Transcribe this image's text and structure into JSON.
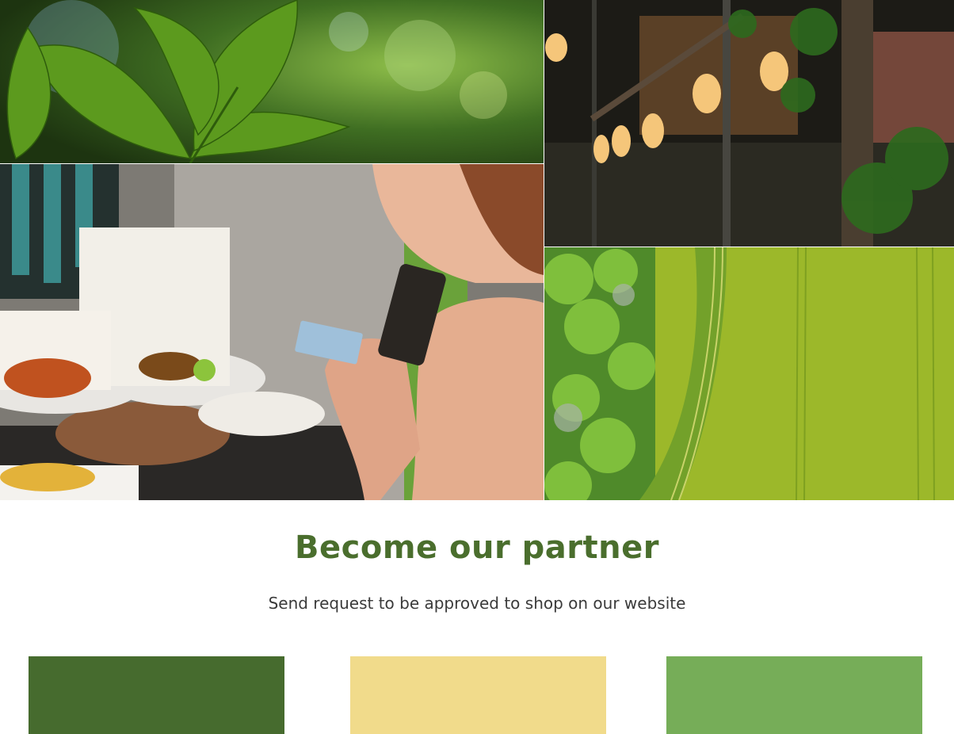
{
  "partner": {
    "title": "Become our partner",
    "subtitle": "Send request to be approved to shop on our website"
  },
  "images": [
    {
      "name": "green-leaves-photo"
    },
    {
      "name": "cafe-lights-photo"
    },
    {
      "name": "food-payment-photo"
    },
    {
      "name": "aerial-field-photo"
    }
  ],
  "cards": [
    {
      "color": "#466b2e"
    },
    {
      "color": "#f1db8b"
    },
    {
      "color": "#76ad58"
    }
  ],
  "colors": {
    "accent": "#4a6e2d",
    "text": "#3a3a3a"
  }
}
